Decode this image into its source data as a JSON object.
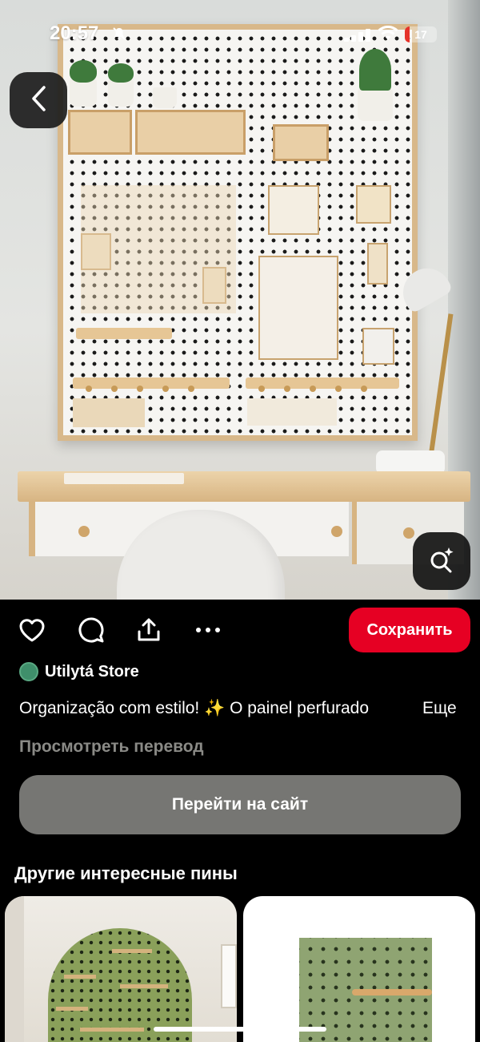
{
  "status_bar": {
    "time": "20:57",
    "battery": "17",
    "icons": [
      "mute-bell-icon",
      "cellular-signal-icon",
      "wifi-icon",
      "battery-icon"
    ]
  },
  "hero": {
    "description": "Pegboard wall organizer above a wooden desk with white chair and lamp",
    "icons": {
      "back": "chevron-left-icon",
      "visual_search": "lens-search-icon"
    }
  },
  "actions": {
    "icons": [
      "heart-icon",
      "comment-icon",
      "share-icon",
      "more-icon"
    ],
    "save_label": "Сохранить",
    "save_color": "#e60023"
  },
  "pin": {
    "author": "Utilytá Store",
    "description": "Organização com estilo! ✨  O painel perfurado",
    "more_label": "Еще",
    "translate_label": "Просмотреть перевод",
    "visit_label": "Перейти на сайт"
  },
  "related": {
    "title": "Другие интересные пины"
  },
  "colors": {
    "background": "#000000",
    "button_gray": "#767673",
    "muted_text": "#8a8a86"
  }
}
